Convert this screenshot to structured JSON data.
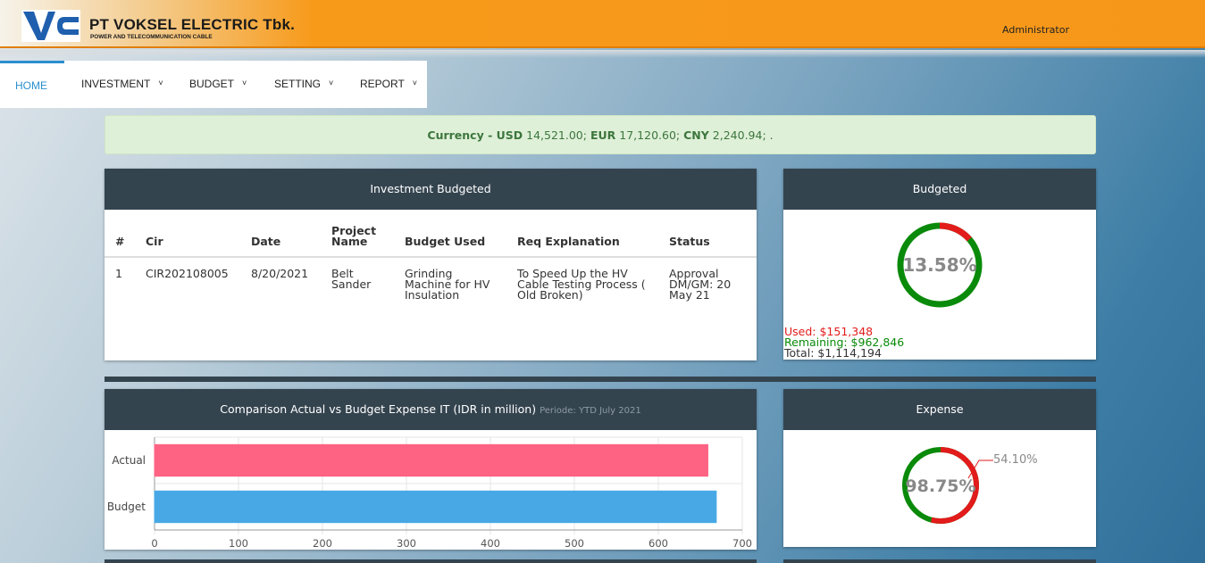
{
  "header": {
    "logo_text": "VC",
    "company_name": "PT VOKSEL ELECTRIC Tbk.",
    "company_tagline": "POWER AND TELECOMMUNICATION CABLE",
    "user": "Administrator"
  },
  "nav": {
    "items": [
      {
        "label": "HOME",
        "active": true
      },
      {
        "label": "INVESTMENT",
        "has_dropdown": true
      },
      {
        "label": "BUDGET",
        "has_dropdown": true
      },
      {
        "label": "SETTING",
        "has_dropdown": true
      },
      {
        "label": "REPORT",
        "has_dropdown": true
      }
    ],
    "caret": "˅"
  },
  "currency": {
    "label": "Currency - ",
    "usd_code": "USD",
    "usd_value": "14,521.00;",
    "eur_code": "EUR",
    "eur_value": "17,120.60;",
    "cny_code": "CNY",
    "cny_value": "2,240.94; ."
  },
  "investment": {
    "title": "Investment Budgeted",
    "columns": [
      "#",
      "Cir",
      "Date",
      "Project Name",
      "Budget Used",
      "Req Explanation",
      "Status"
    ],
    "rows": [
      [
        "1",
        "CIR202108005",
        "8/20/2021",
        "Belt Sander",
        "Grinding Machine for HV Insulation",
        "To Speed Up the HV Cable Testing Process ( Old Broken)",
        "Approval DM/GM: 20 May 21"
      ]
    ]
  },
  "budgeted": {
    "title": "Budgeted",
    "percent_label": "13.58%",
    "fraction": 0.1358,
    "used": "Used: $151,348",
    "remaining": "Remaining: $962,846",
    "total": "Total: $1,114,194",
    "used_color": "#e21b1b",
    "remaining_color": "#0a8a0a"
  },
  "comparison": {
    "title": "Comparison Actual vs Budget Expense IT (IDR in million)",
    "period": "Periode: YTD July 2021"
  },
  "chart_data": {
    "type": "bar",
    "orientation": "horizontal",
    "categories": [
      "Actual",
      "Budget"
    ],
    "values": [
      659,
      669
    ],
    "colors": [
      "#ff6384",
      "#48a8e6"
    ],
    "xlim": [
      0,
      700
    ],
    "xticks": [
      "0",
      "100",
      "200",
      "300",
      "400",
      "500",
      "600",
      "700"
    ],
    "grid": true
  },
  "expense": {
    "title": "Expense",
    "percent_label": "98.75%",
    "callout": "54.10%",
    "red_fraction": 0.541
  }
}
